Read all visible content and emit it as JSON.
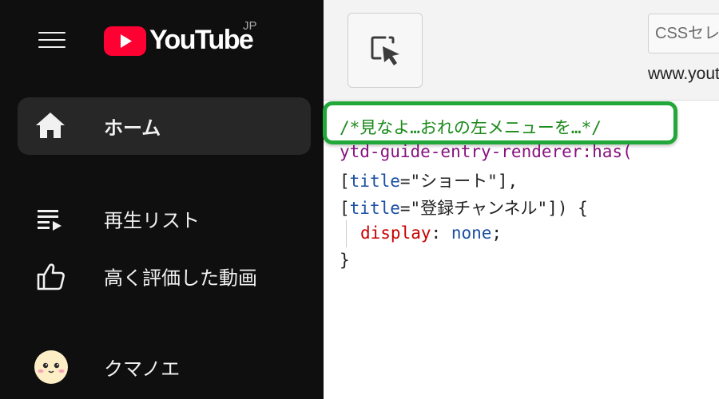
{
  "youtube": {
    "logo_text": "YouTube",
    "region": "JP",
    "nav": [
      {
        "label": "ホーム",
        "icon": "home-icon",
        "active": true
      },
      {
        "label": "再生リスト",
        "icon": "playlist-icon",
        "active": false
      },
      {
        "label": "高く評価した動画",
        "icon": "thumbs-up-icon",
        "active": false
      },
      {
        "label": "クマノエ",
        "icon": "avatar",
        "active": false
      }
    ],
    "colors": {
      "background": "#0f0f0f",
      "active_item": "#272727",
      "brand_red": "#ff0033"
    }
  },
  "devtools": {
    "inspect_icon": "select-element-icon",
    "selector_placeholder": "CSSセレク",
    "origin_text": "www.yout",
    "code": {
      "comment": "/*見なよ…おれの左メニューを…*/",
      "selector": "ytd-guide-entry-renderer:has(",
      "line2": {
        "open": "[",
        "attr": "title",
        "eq": "=",
        "value": "\"ショート\"",
        "close": "],"
      },
      "line3": {
        "open": "[",
        "attr": "title",
        "eq": "=",
        "value": "\"登録チャンネル\"",
        "close": "]) {"
      },
      "declaration": {
        "property": "display",
        "colon": ":",
        "value": "none",
        "semi": ";"
      },
      "closing_brace": "}"
    },
    "highlight_color": "#22a83a"
  }
}
